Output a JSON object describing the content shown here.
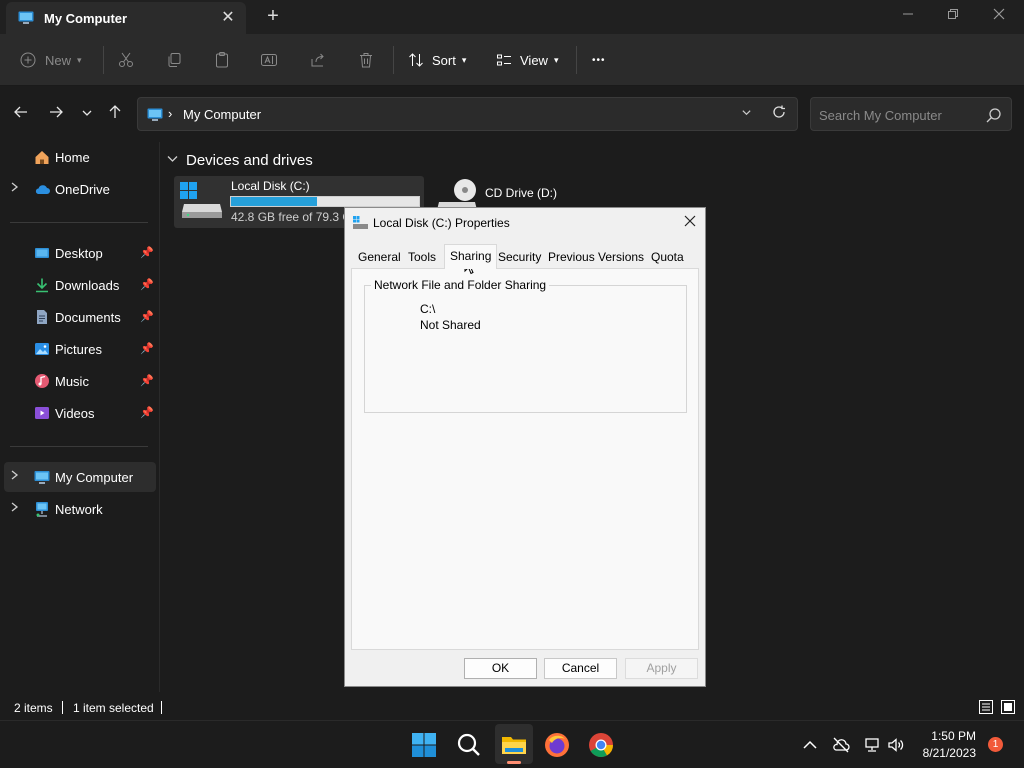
{
  "window": {
    "tab_title": "My Computer",
    "close_glyph": "✕",
    "new_tab_glyph": "+"
  },
  "toolbar": {
    "new_label": "New",
    "sort_label": "Sort",
    "view_label": "View",
    "more_glyph": "•••"
  },
  "address": {
    "separator": "›",
    "location": "My Computer"
  },
  "search": {
    "placeholder": "Search My Computer"
  },
  "sidebar": {
    "items": [
      {
        "label": "Home",
        "icon": "home-icon"
      },
      {
        "label": "OneDrive",
        "icon": "cloud-icon"
      },
      {
        "label": "Desktop",
        "icon": "desktop-icon"
      },
      {
        "label": "Downloads",
        "icon": "download-icon"
      },
      {
        "label": "Documents",
        "icon": "documents-icon"
      },
      {
        "label": "Pictures",
        "icon": "pictures-icon"
      },
      {
        "label": "Music",
        "icon": "music-icon"
      },
      {
        "label": "Videos",
        "icon": "videos-icon"
      },
      {
        "label": "My Computer",
        "icon": "computer-icon"
      },
      {
        "label": "Network",
        "icon": "network-icon"
      }
    ]
  },
  "content": {
    "group_heading": "Devices and drives",
    "drives": [
      {
        "name": "Local Disk (C:)",
        "free_text": "42.8 GB free of 79.3 GB",
        "used_fraction": 0.46
      },
      {
        "name": "CD Drive (D:)"
      }
    ]
  },
  "status": {
    "item_count": "2 items",
    "selection": "1 item selected"
  },
  "dialog": {
    "title": "Local Disk (C:) Properties",
    "tabs": [
      "General",
      "Tools",
      "Sharing",
      "Security",
      "Previous Versions",
      "Quota"
    ],
    "active_tab": "Sharing",
    "group_label": "Network File and Folder Sharing",
    "share_path": "C:\\",
    "share_status": "Not Shared",
    "buttons": {
      "ok": "OK",
      "cancel": "Cancel",
      "apply": "Apply"
    }
  },
  "taskbar": {
    "time": "1:50 PM",
    "date": "8/21/2023",
    "notification_count": "1"
  },
  "colors": {
    "accent": "#26a0da",
    "background": "#1c1c1c",
    "notification": "#f25a3a"
  }
}
